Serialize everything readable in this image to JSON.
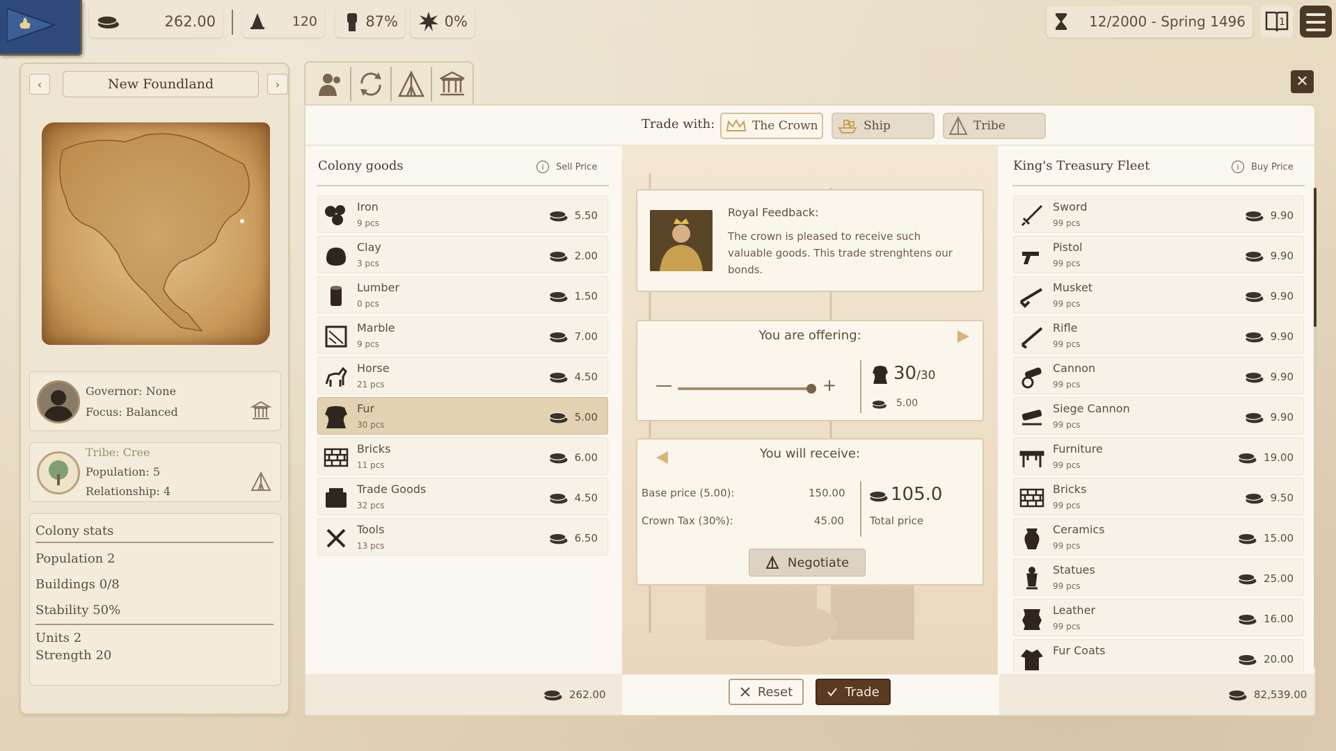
{
  "topbar": {
    "gold": "262.00",
    "population": "120",
    "approval": "87%",
    "unrest": "0%",
    "date": "12/2000 - Spring 1496",
    "book_badge": "1"
  },
  "colony": {
    "name": "New Foundland",
    "prev": "‹",
    "next": "›",
    "governor": "Governor: None",
    "focus": "Focus: Balanced",
    "tribe": "Tribe: Cree",
    "tribe_population": "Population: 5",
    "relationship": "Relationship: 4",
    "stats_title": "Colony stats",
    "stats": {
      "population": "Population 2",
      "buildings": "Buildings 0/8",
      "stability": "Stability 50%",
      "units": "Units 2",
      "strength": "Strength 20"
    }
  },
  "trade": {
    "trade_with_label": "Trade with:",
    "partners": [
      "The Crown",
      "Ship",
      "Tribe"
    ],
    "active_partner": "The Crown",
    "close": "✕"
  },
  "colony_goods": {
    "title": "Colony goods",
    "price_label": "Sell Price",
    "items": [
      {
        "name": "Iron",
        "qty": "9 pcs",
        "price": "5.50",
        "icon": "iron-icon"
      },
      {
        "name": "Clay",
        "qty": "3 pcs",
        "price": "2.00",
        "icon": "clay-icon"
      },
      {
        "name": "Lumber",
        "qty": "0 pcs",
        "price": "1.50",
        "icon": "lumber-icon"
      },
      {
        "name": "Marble",
        "qty": "9 pcs",
        "price": "7.00",
        "icon": "marble-icon"
      },
      {
        "name": "Horse",
        "qty": "21 pcs",
        "price": "4.50",
        "icon": "horse-icon"
      },
      {
        "name": "Fur",
        "qty": "30 pcs",
        "price": "5.00",
        "icon": "fur-icon",
        "selected": true
      },
      {
        "name": "Bricks",
        "qty": "11 pcs",
        "price": "6.00",
        "icon": "bricks-icon"
      },
      {
        "name": "Trade Goods",
        "qty": "32 pcs",
        "price": "4.50",
        "icon": "trade-goods-icon"
      },
      {
        "name": "Tools",
        "qty": "13 pcs",
        "price": "6.50",
        "icon": "tools-icon"
      }
    ],
    "treasury": "262.00"
  },
  "fleet": {
    "title": "King's Treasury Fleet",
    "price_label": "Buy Price",
    "items": [
      {
        "name": "Sword",
        "qty": "99 pcs",
        "price": "9.90",
        "icon": "sword-icon"
      },
      {
        "name": "Pistol",
        "qty": "99 pcs",
        "price": "9.90",
        "icon": "pistol-icon"
      },
      {
        "name": "Musket",
        "qty": "99 pcs",
        "price": "9.90",
        "icon": "musket-icon"
      },
      {
        "name": "Rifle",
        "qty": "99 pcs",
        "price": "9.90",
        "icon": "rifle-icon"
      },
      {
        "name": "Cannon",
        "qty": "99 pcs",
        "price": "9.90",
        "icon": "cannon-icon"
      },
      {
        "name": "Siege Cannon",
        "qty": "99 pcs",
        "price": "9.90",
        "icon": "siege-cannon-icon"
      },
      {
        "name": "Furniture",
        "qty": "99 pcs",
        "price": "19.00",
        "icon": "furniture-icon"
      },
      {
        "name": "Bricks",
        "qty": "99 pcs",
        "price": "9.50",
        "icon": "bricks-icon"
      },
      {
        "name": "Ceramics",
        "qty": "99 pcs",
        "price": "15.00",
        "icon": "ceramics-icon"
      },
      {
        "name": "Statues",
        "qty": "99 pcs",
        "price": "25.00",
        "icon": "statues-icon"
      },
      {
        "name": "Leather",
        "qty": "99 pcs",
        "price": "16.00",
        "icon": "leather-icon"
      },
      {
        "name": "Fur Coats",
        "qty": "",
        "price": "20.00",
        "icon": "fur-coats-icon"
      }
    ],
    "treasury": "82,539.00"
  },
  "feedback": {
    "title": "Royal Feedback:",
    "text": "The crown is pleased to receive such valuable goods. This trade strenghtens our bonds."
  },
  "offer": {
    "title": "You are offering:",
    "amount": "30",
    "max": "/30",
    "unit_price": "5.00",
    "slider_fraction": 1.0,
    "minus": "—",
    "plus": "+"
  },
  "receive": {
    "title": "You will receive:",
    "base_label": "Base price (5.00):",
    "base_value": "150.00",
    "tax_label": "Crown Tax (30%):",
    "tax_value": "45.00",
    "total": "105.0",
    "total_label": "Total price",
    "negotiate": "Negotiate"
  },
  "actions": {
    "reset": "Reset",
    "trade": "Trade"
  },
  "colors": {
    "accent_dark": "#4b3826",
    "selected_row": "#e3d2b2",
    "trade_button": "#5b3a22"
  }
}
